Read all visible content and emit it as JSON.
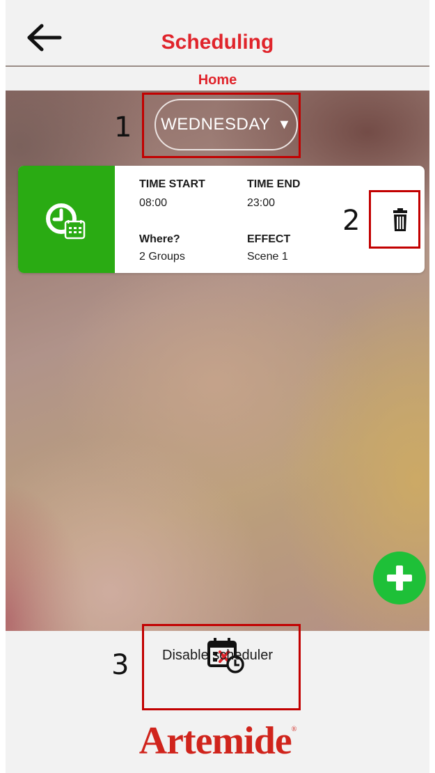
{
  "header": {
    "title": "Scheduling",
    "subtitle": "Home"
  },
  "day_selector": {
    "value": "WEDNESDAY",
    "caret": "▼"
  },
  "schedule": {
    "time_start_label": "TIME START",
    "time_start_value": "08:00",
    "time_end_label": "TIME END",
    "time_end_value": "23:00",
    "where_label": "Where?",
    "where_value": "2 Groups",
    "effect_label": "EFFECT",
    "effect_value": "Scene 1"
  },
  "annotations": [
    "1",
    "2",
    "3"
  ],
  "bottom": {
    "disable_label": "Disable scheduler",
    "logo": "Artemide",
    "logo_mark": "®"
  },
  "colors": {
    "accent": "#e0242b",
    "card_green": "#2aab13",
    "fab_green": "#1ec038",
    "annotation": "#c20000"
  },
  "icons": {
    "back": "arrow-left-icon",
    "schedule": "clock-calendar-icon",
    "delete": "trash-icon",
    "add": "plus-icon",
    "disable": "calendar-x-clock-icon"
  }
}
